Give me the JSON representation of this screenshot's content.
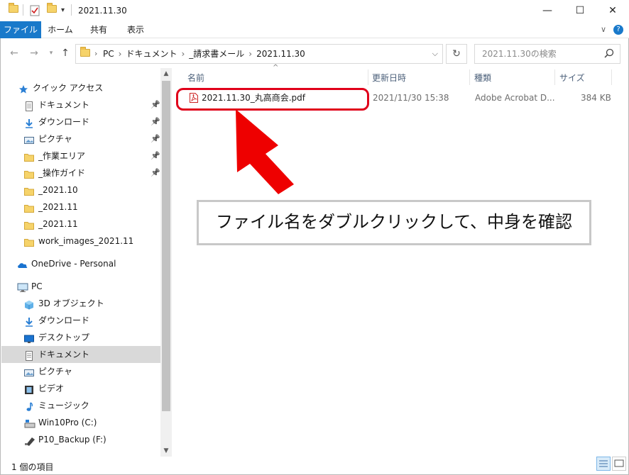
{
  "window": {
    "title": "2021.11.30",
    "controls": {
      "minimize": "—",
      "maximize": "☐",
      "close": "✕"
    },
    "ribbon_chevron": "∨",
    "help": "?"
  },
  "ribbon": {
    "tabs": [
      {
        "label": "ファイル"
      },
      {
        "label": "ホーム"
      },
      {
        "label": "共有"
      },
      {
        "label": "表示"
      }
    ]
  },
  "address": {
    "path": [
      "PC",
      "ドキュメント",
      "_請求書メール",
      "2021.11.30"
    ],
    "search_placeholder": "2021.11.30の検索"
  },
  "nav": {
    "items": [
      {
        "label": "クイック アクセス",
        "icon": "star-icon",
        "pinned": false
      },
      {
        "label": "ドキュメント",
        "icon": "document-icon",
        "pinned": true
      },
      {
        "label": "ダウンロード",
        "icon": "download-icon",
        "pinned": true
      },
      {
        "label": "ピクチャ",
        "icon": "pictures-icon",
        "pinned": true
      },
      {
        "label": "_作業エリア",
        "icon": "folder-icon",
        "pinned": true
      },
      {
        "label": "_操作ガイド",
        "icon": "folder-icon",
        "pinned": true
      },
      {
        "label": "_2021.10",
        "icon": "folder-icon",
        "pinned": false
      },
      {
        "label": "_2021.11",
        "icon": "folder-icon",
        "pinned": false
      },
      {
        "label": "_2021.11",
        "icon": "folder-icon",
        "pinned": false
      },
      {
        "label": "work_images_2021.11",
        "icon": "folder-icon",
        "pinned": false
      },
      {
        "label": "OneDrive - Personal",
        "icon": "cloud-icon",
        "pinned": false
      },
      {
        "label": "PC",
        "icon": "pc-icon",
        "pinned": false
      },
      {
        "label": "3D オブジェクト",
        "icon": "cube-icon",
        "pinned": false
      },
      {
        "label": "ダウンロード",
        "icon": "download-icon",
        "pinned": false
      },
      {
        "label": "デスクトップ",
        "icon": "desktop-icon",
        "pinned": false
      },
      {
        "label": "ドキュメント",
        "icon": "document-icon",
        "pinned": false
      },
      {
        "label": "ピクチャ",
        "icon": "pictures-icon",
        "pinned": false
      },
      {
        "label": "ビデオ",
        "icon": "video-icon",
        "pinned": false
      },
      {
        "label": "ミュージック",
        "icon": "music-icon",
        "pinned": false
      },
      {
        "label": "Win10Pro (C:)",
        "icon": "drive-icon",
        "pinned": false
      },
      {
        "label": "P10_Backup (F:)",
        "icon": "usb-drive-icon",
        "pinned": false
      }
    ],
    "selected_label": "ドキュメント"
  },
  "columns": {
    "name": "名前",
    "date": "更新日時",
    "type": "種類",
    "size": "サイズ"
  },
  "files": [
    {
      "name": "2021.11.30_丸高商会.pdf",
      "date": "2021/11/30 15:38",
      "type": "Adobe Acrobat D...",
      "size": "384 KB"
    }
  ],
  "annotation": {
    "callout": "ファイル名をダブルクリックして、中身を確認",
    "color": "#e0001a"
  },
  "status": {
    "items": "1 個の項目"
  },
  "colors": {
    "accent": "#1979ca",
    "selection": "#d9d9d9"
  }
}
